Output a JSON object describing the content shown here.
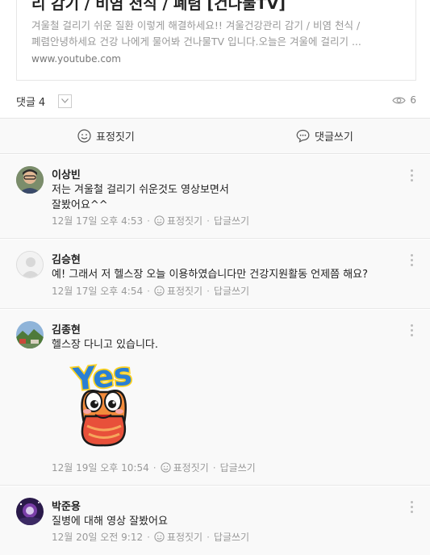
{
  "link_card": {
    "title": "리 감기 / 비염 천식 / 폐렴 [건나물TV]",
    "desc_line1": "겨울철 걸리기 쉬운 질환 이렇게 해결하세요!! 겨울건강관리 감기 / 비염 천식 /",
    "desc_line2": "폐렴안녕하세요 건강 나에게 물어봐 건나물TV 입니다.오늘은 겨울에 걸리기 ...",
    "domain": "www.youtube.com"
  },
  "comment_count": {
    "label": "댓글",
    "count": "4"
  },
  "views": "6",
  "actions": {
    "react": "표정짓기",
    "reply": "댓글쓰기"
  },
  "comments": [
    {
      "author": "이상빈",
      "text": "저는 겨울철 걸리기 쉬운것도 영상보면서\n잘봤어요^^",
      "time": "12월 17일 오후 4:53",
      "react": "표정짓기",
      "reply": "답글쓰기",
      "avatar": "person-photo"
    },
    {
      "author": "김승현",
      "text": "예! 그래서 저 헬스장 오늘 이용하였습니다만 건강지원활동 언제쯤 해요?",
      "time": "12월 17일 오후 4:54",
      "react": "표정짓기",
      "reply": "답글쓰기",
      "avatar": "default-avatar"
    },
    {
      "author": "김종현",
      "text": "헬스장 다니고 있습니다.",
      "time": "12월 19일 오후 10:54",
      "react": "표정짓기",
      "reply": "답글쓰기",
      "avatar": "landscape-photo",
      "sticker": "yes-sticker",
      "sticker_text": "Yes"
    },
    {
      "author": "박준용",
      "text": "질병에 대해 영상 잘봤어요",
      "time": "12월 20일 오전 9:12",
      "react": "표정짓기",
      "reply": "답글쓰기",
      "avatar": "night-photo"
    }
  ],
  "colors": {
    "action_bg": "#f9f9f9",
    "muted": "#999999",
    "sticker_blue": "#2a7fd4",
    "sticker_yellow": "#ffd21f",
    "sticker_red": "#e8503a"
  }
}
